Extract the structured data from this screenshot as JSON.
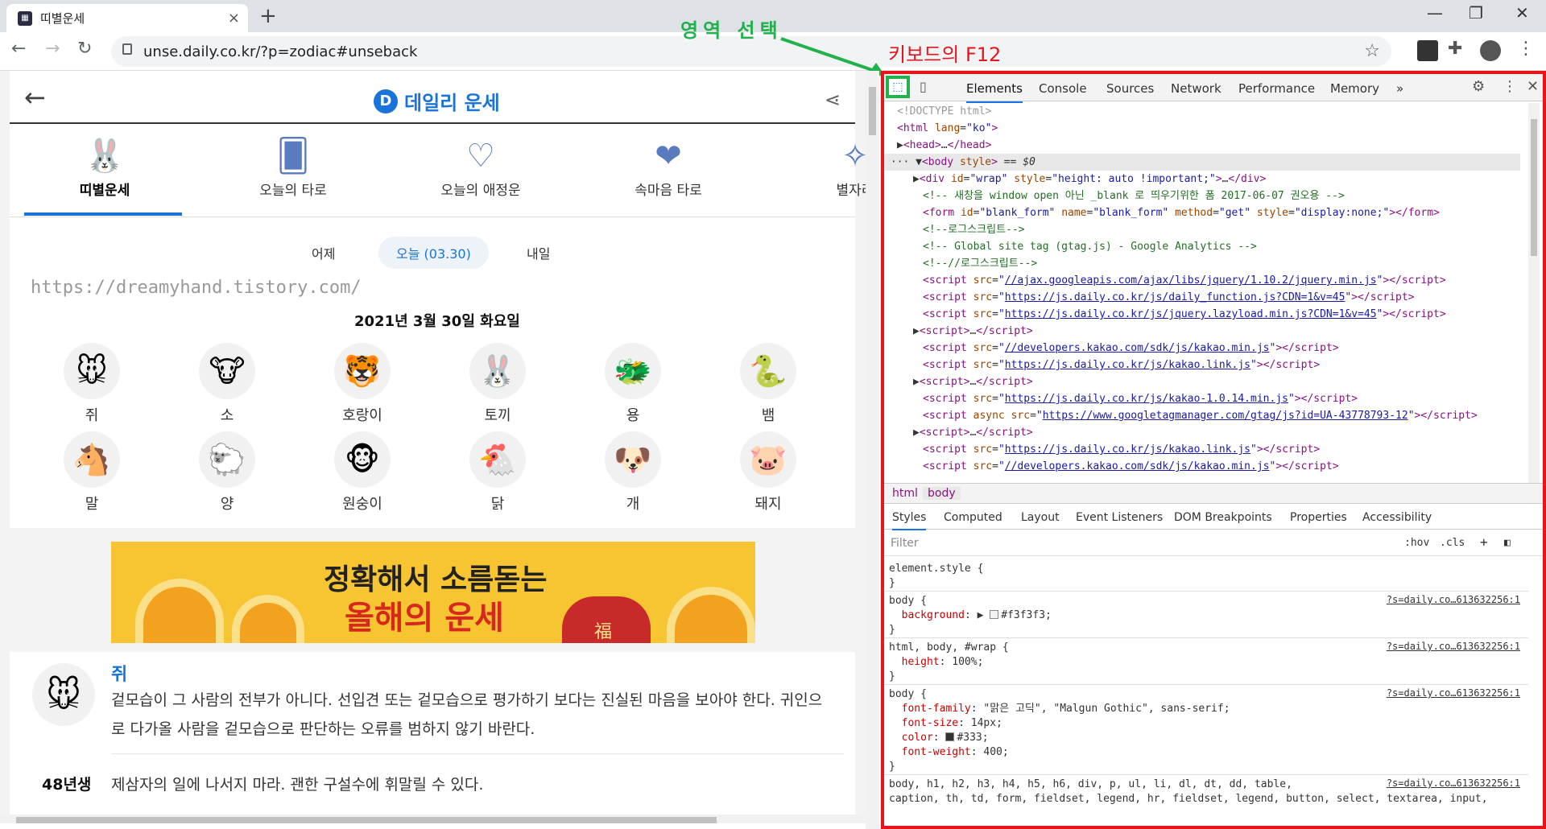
{
  "browser": {
    "tab_title": "띠별운세",
    "tab_close": "×",
    "new_tab": "+",
    "url": "unse.daily.co.kr/?p=zodiac#unseback",
    "minimize": "—",
    "maximize": "❐",
    "close": "✕"
  },
  "annotations": {
    "select_area": "영역 선택",
    "keyboard_f12": "키보드의 F12"
  },
  "site": {
    "logo_text": "데일리 운세",
    "logo_letter": "D",
    "categories": [
      {
        "label": "띠별운세"
      },
      {
        "label": "오늘의 타로"
      },
      {
        "label": "오늘의 애정운"
      },
      {
        "label": "속마음 타로"
      },
      {
        "label": "별자리"
      }
    ],
    "days": [
      "어제",
      "오늘 (03.30)",
      "내일"
    ],
    "watermark": "https://dreamyhand.tistory.com/",
    "date": "2021년 3월 30일 화요일",
    "animals": [
      "쥐",
      "소",
      "호랑이",
      "토끼",
      "용",
      "뱀",
      "말",
      "양",
      "원숭이",
      "닭",
      "개",
      "돼지"
    ],
    "banner_line1": "정확해서 소름돋는",
    "banner_line2": "올해의 운세",
    "banner_bag_text": "福",
    "fortune_title": "쥐",
    "fortune_text": "겉모습이 그 사람의 전부가 아니다. 선입견 또는 겉모습으로 평가하기 보다는 진실된 마음을 보아야 한다. 귀인으로 다가올 사람을 겉모습으로 판단하는 오류를 범하지 않기 바란다.",
    "year_label": "48년생",
    "year_text": "제삼자의 일에 나서지 마라. 괜한 구설수에 휘말릴 수 있다."
  },
  "devtools": {
    "tabs": [
      "Elements",
      "Console",
      "Sources",
      "Network",
      "Performance",
      "Memory"
    ],
    "more": "»",
    "breadcrumb": [
      "html",
      "body"
    ],
    "style_tabs": [
      "Styles",
      "Computed",
      "Layout",
      "Event Listeners",
      "DOM Breakpoints",
      "Properties",
      "Accessibility"
    ],
    "filter_placeholder": "Filter",
    "hov": ":hov",
    "cls": ".cls",
    "rule_source": "?s=daily.co…613632256:1"
  },
  "colors": {
    "annotation_green": "#22b14c",
    "annotation_red": "#e8141c",
    "brand_blue": "#1a73d9"
  }
}
